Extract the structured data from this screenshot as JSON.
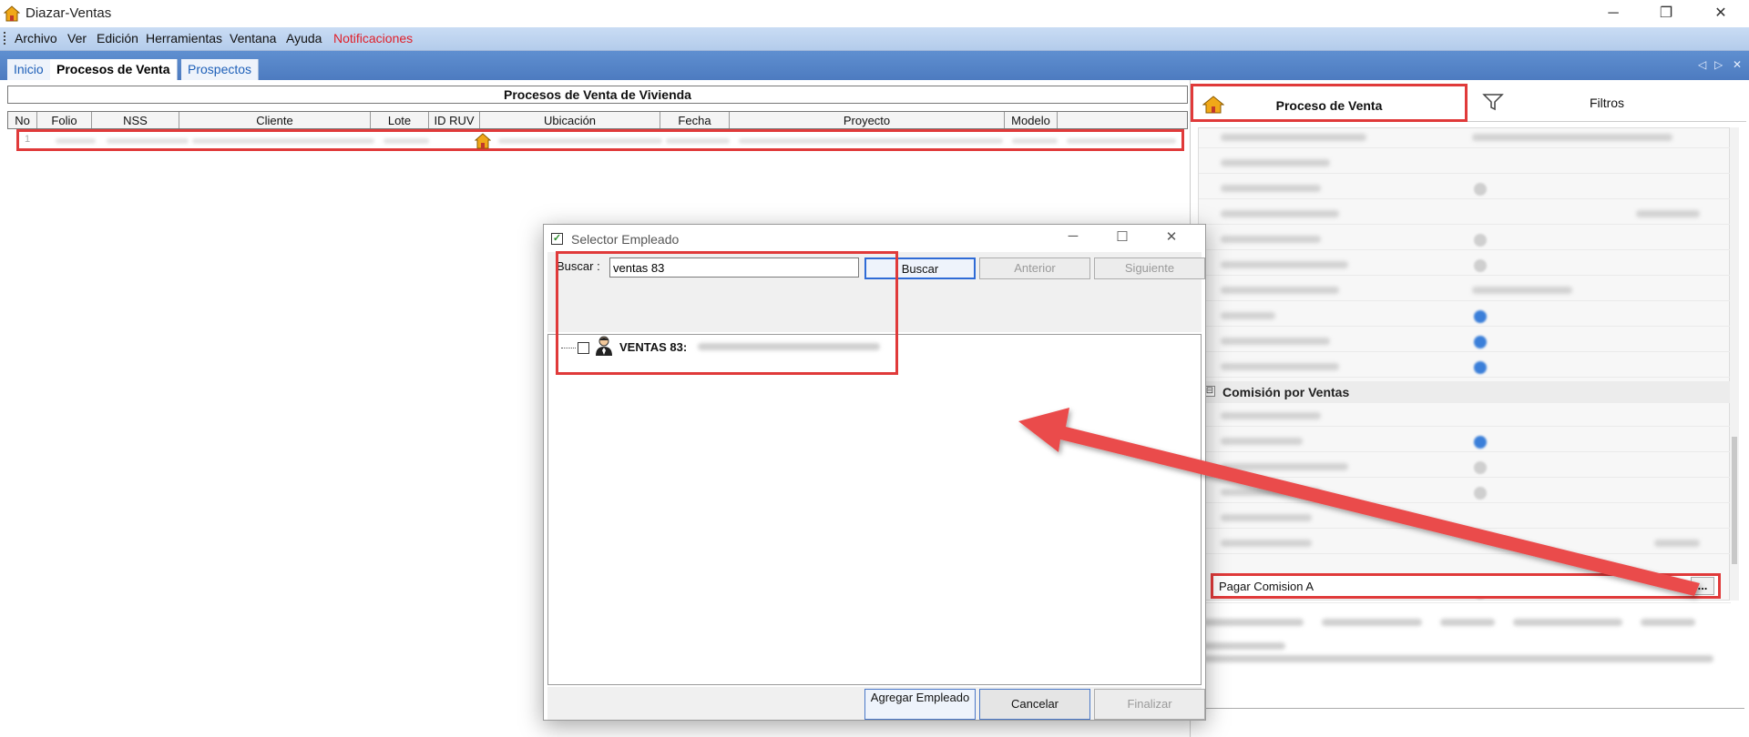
{
  "window": {
    "title": "Diazar-Ventas",
    "minimize": "─",
    "restore": "❐",
    "close": "✕"
  },
  "menu": {
    "items": [
      "Archivo",
      "Ver",
      "Edición",
      "Herramientas",
      "Ventana",
      "Ayuda"
    ],
    "notifications": "Notificaciones",
    "notifications_color": "#e0202a"
  },
  "tabs": [
    {
      "label": "Inicio",
      "active": false
    },
    {
      "label": "Procesos de Venta",
      "active": true
    },
    {
      "label": "Prospectos",
      "active": false
    }
  ],
  "tab_controls": {
    "prev": "◁",
    "next": "▷",
    "close": "✕"
  },
  "grid": {
    "title": "Procesos de Venta de Vivienda",
    "columns": [
      "No",
      "Folio",
      "NSS",
      "Cliente",
      "Lote",
      "ID RUV",
      "Ubicación",
      "Fecha",
      "Proyecto",
      "Modelo"
    ],
    "row_number": "1"
  },
  "right_panel": {
    "tab_process": "Proceso de Venta",
    "tab_filters": "Filtros",
    "section_commission": "Comisión por Ventas",
    "section_toggle": "⊟",
    "pagar_label": "Pagar Comision A",
    "pagar_button": "..."
  },
  "dialog": {
    "title": "Selector Empleado",
    "title_check": "✓",
    "minimize": "─",
    "maximize": "☐",
    "close": "✕",
    "search_label": "Buscar :",
    "search_value": "ventas 83",
    "buscar": "Buscar",
    "anterior": "Anterior",
    "siguiente": "Siguiente",
    "tree_item_label": "VENTAS 83:",
    "agregar": "Agregar Empleado",
    "cancelar": "Cancelar",
    "finalizar": "Finalizar"
  },
  "colors": {
    "highlight": "#e03a3a",
    "accent": "#2f6bd6",
    "tabbar": "#5f8fd0"
  }
}
